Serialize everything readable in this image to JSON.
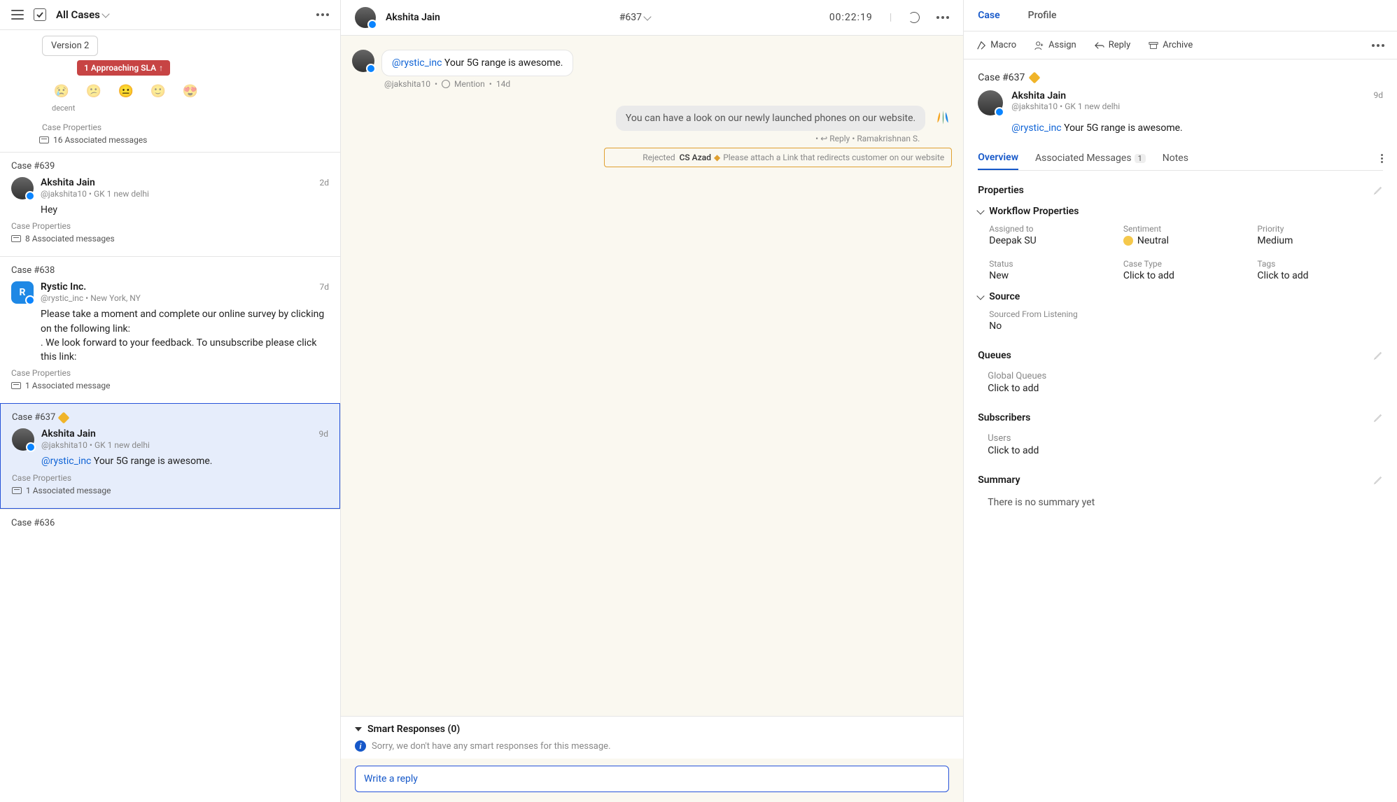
{
  "left": {
    "filter_label": "All Cases",
    "top_chip": "Version 2",
    "sla_badge": "1 Approaching SLA",
    "emoji_label": "decent",
    "top_props": "Case Properties",
    "top_assoc": "16 Associated messages",
    "cases": [
      {
        "num": "Case #639",
        "name": "Akshita Jain",
        "handle": "@jakshita10",
        "loc": "GK 1 new delhi",
        "time": "2d",
        "msg": "Hey",
        "props": "Case Properties",
        "assoc": "8 Associated messages"
      },
      {
        "num": "Case #638",
        "name": "Rystic Inc.",
        "handle": "@rystic_inc",
        "loc": "New York, NY",
        "time": "7d",
        "msg": "Please take a moment and complete our online survey by clicking on the following link:\n . We look forward to your feedback. To unsubscribe please click this link:",
        "props": "Case Properties",
        "assoc": "1 Associated message",
        "rystic": true
      },
      {
        "num": "Case #637",
        "name": "Akshita Jain",
        "handle": "@jakshita10",
        "loc": "GK 1 new delhi",
        "time": "9d",
        "mention": "@rystic_inc",
        "msg": " Your 5G range is awesome.",
        "props": "Case Properties",
        "assoc": "1 Associated message",
        "selected": true,
        "diamond": true
      },
      {
        "num": "Case #636"
      }
    ]
  },
  "center": {
    "header_name": "Akshita Jain",
    "case_num": "#637",
    "timer": "00:22:19",
    "in_mention": "@rystic_inc",
    "in_text": " Your 5G range is awesome.",
    "in_meta_handle": "@jakshita10",
    "in_meta_type": "Mention",
    "in_meta_time": "14d",
    "out_text": "You can have a look on our newly launched phones on our website.",
    "out_meta_reply": "Reply",
    "out_meta_who": "Ramakrishnan S.",
    "reject_status": "Rejected",
    "reject_by": "CS Azad",
    "reject_msg": "Please attach a Link that redirects customer on our website",
    "smart_title": "Smart Responses (0)",
    "smart_empty": "Sorry, we don't have any smart responses for this message.",
    "reply_placeholder": "Write a reply"
  },
  "right": {
    "tabs": {
      "case": "Case",
      "profile": "Profile"
    },
    "actions": {
      "macro": "Macro",
      "assign": "Assign",
      "reply": "Reply",
      "archive": "Archive"
    },
    "case_title": "Case #637",
    "card": {
      "name": "Akshita Jain",
      "handle": "@jakshita10",
      "loc": "GK 1 new delhi",
      "time": "9d",
      "mention": "@rystic_inc",
      "msg": " Your 5G range is awesome."
    },
    "subtabs": {
      "overview": "Overview",
      "assoc": "Associated Messages",
      "assoc_count": "1",
      "notes": "Notes"
    },
    "properties_title": "Properties",
    "workflow_title": "Workflow Properties",
    "props": {
      "assigned_l": "Assigned to",
      "assigned_v": "Deepak SU",
      "sentiment_l": "Sentiment",
      "sentiment_v": "Neutral",
      "priority_l": "Priority",
      "priority_v": "Medium",
      "status_l": "Status",
      "status_v": "New",
      "casetype_l": "Case Type",
      "casetype_v": "Click to add",
      "tags_l": "Tags",
      "tags_v": "Click to add"
    },
    "source_title": "Source",
    "source_l": "Sourced From Listening",
    "source_v": "No",
    "queues_title": "Queues",
    "queues_l": "Global Queues",
    "queues_v": "Click to add",
    "subs_title": "Subscribers",
    "subs_l": "Users",
    "subs_v": "Click to add",
    "summary_title": "Summary",
    "summary_v": "There is no summary yet"
  }
}
